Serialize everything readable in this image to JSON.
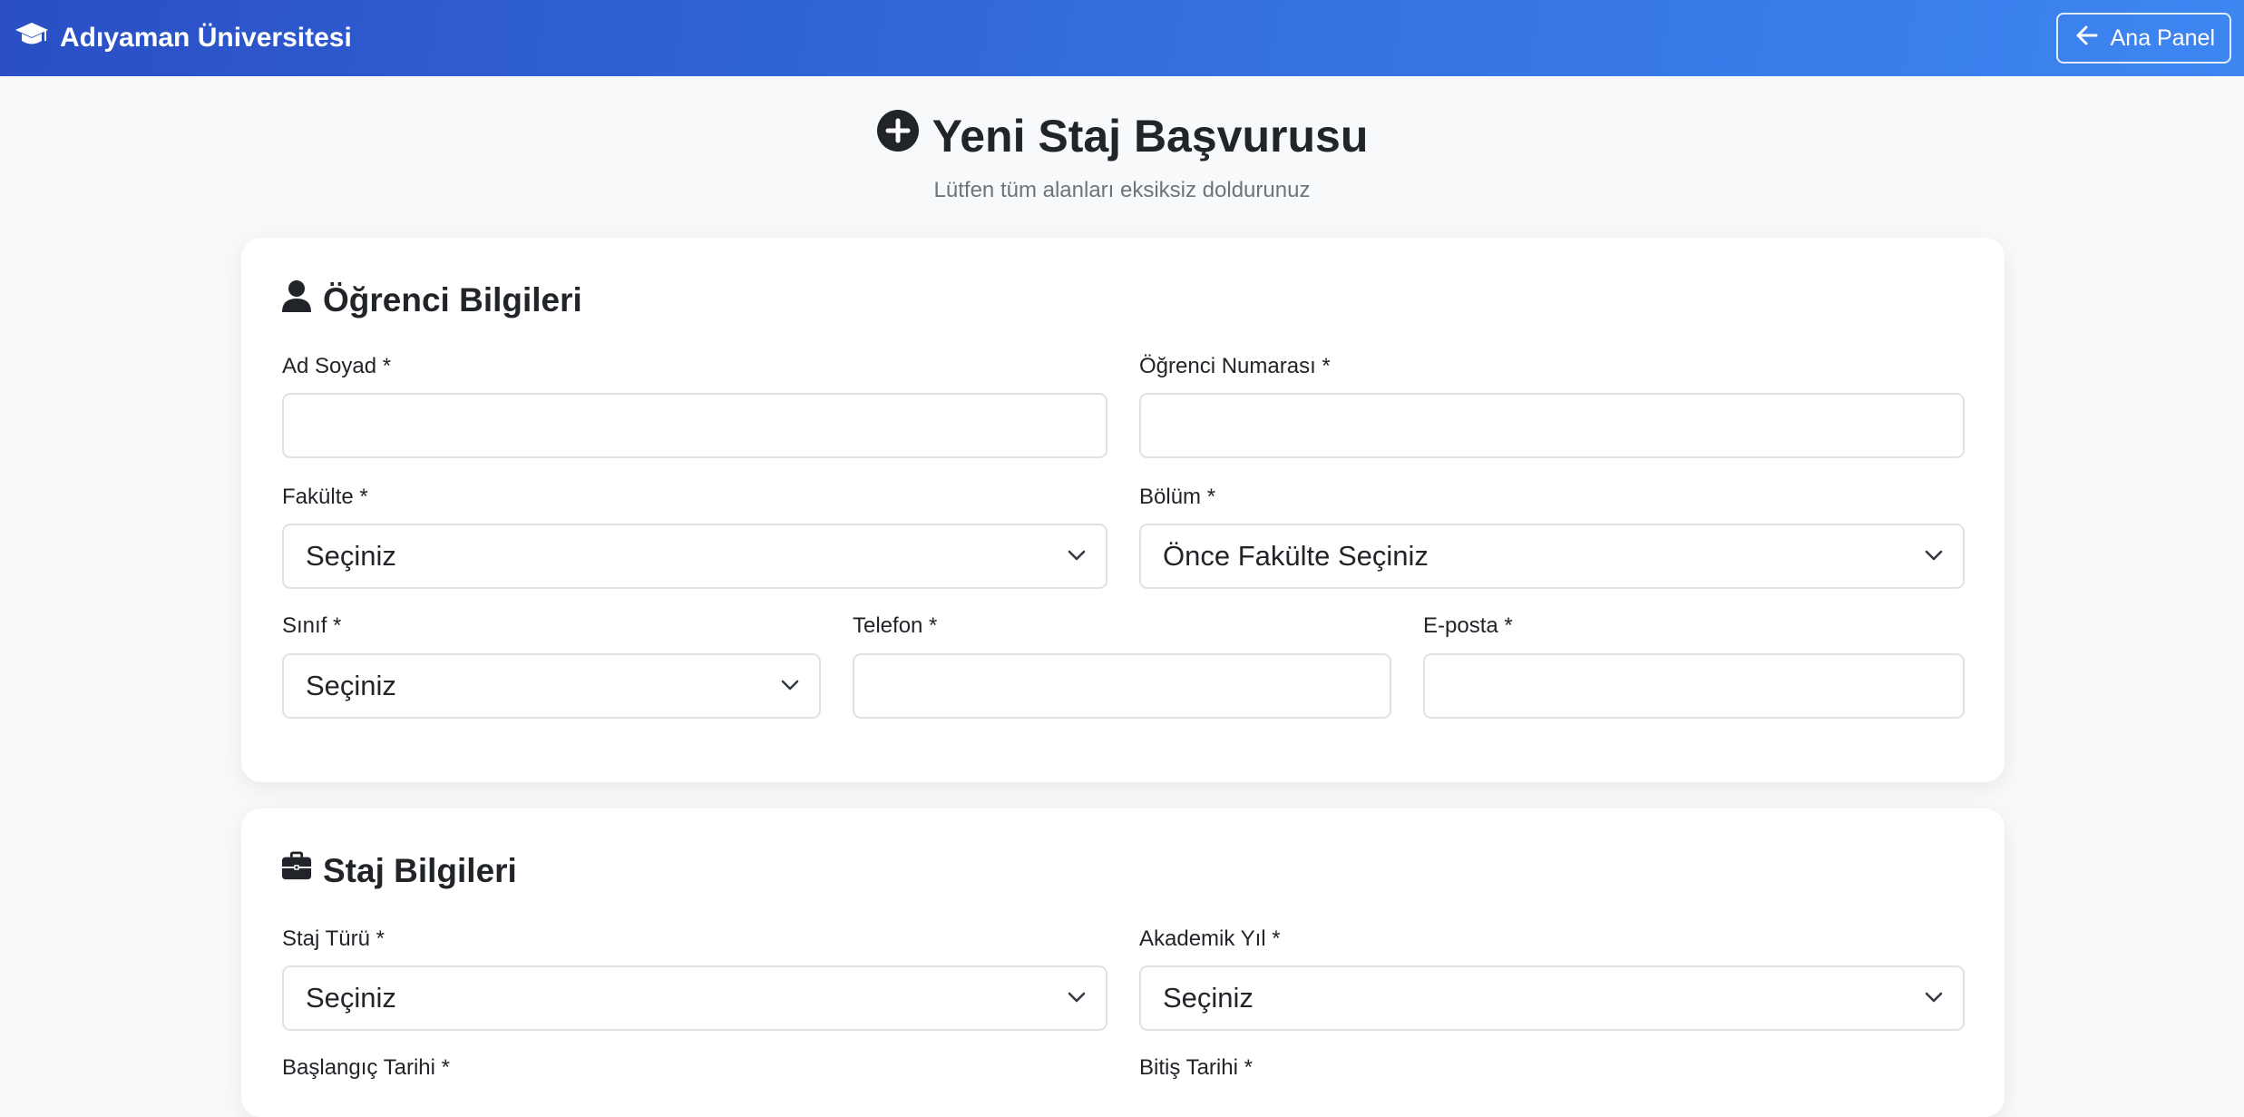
{
  "navbar": {
    "brand": "Adıyaman Üniversitesi",
    "back_button": "Ana Panel"
  },
  "header": {
    "title": "Yeni Staj Başvurusu",
    "subtitle": "Lütfen tüm alanları eksiksiz doldurunuz"
  },
  "student_section": {
    "title": "Öğrenci Bilgileri",
    "name_label": "Ad Soyad *",
    "name_value": "",
    "number_label": "Öğrenci Numarası *",
    "number_value": "",
    "faculty_label": "Fakülte *",
    "faculty_value": "Seçiniz",
    "department_label": "Bölüm *",
    "department_value": "Önce Fakülte Seçiniz",
    "class_label": "Sınıf *",
    "class_value": "Seçiniz",
    "phone_label": "Telefon *",
    "phone_value": "",
    "email_label": "E-posta *",
    "email_value": ""
  },
  "internship_section": {
    "title": "Staj Bilgileri",
    "type_label": "Staj Türü *",
    "type_value": "Seçiniz",
    "year_label": "Akademik Yıl *",
    "year_value": "Seçiniz",
    "start_label": "Başlangıç Tarihi *",
    "end_label": "Bitiş Tarihi *"
  },
  "colors": {
    "navbar_start": "#2a4fc4",
    "navbar_end": "#3d86f2",
    "page_background": "#f8f9fa",
    "text_muted": "#6c757d"
  }
}
